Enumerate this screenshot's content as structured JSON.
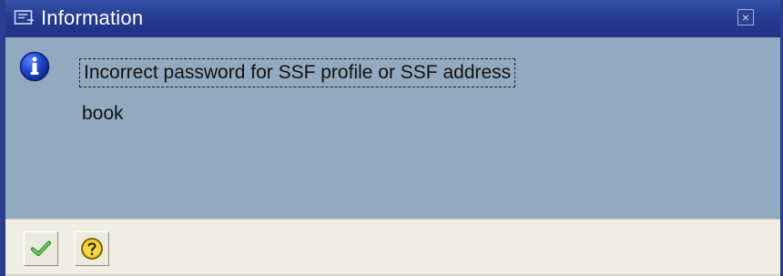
{
  "window": {
    "title": "Information",
    "title_icon": "dialog-icon",
    "close_icon": "close-icon"
  },
  "message": {
    "icon": "info-icon",
    "line1": "Incorrect password for SSF profile or SSF address",
    "line2": "book"
  },
  "footer": {
    "buttons": [
      {
        "name": "ok-button",
        "icon": "checkmark-icon"
      },
      {
        "name": "help-button",
        "icon": "question-icon"
      }
    ]
  },
  "colors": {
    "title_bar": "#23388f",
    "content_bg": "#92aabf",
    "footer_bg": "#efeee2",
    "title_text": "#ffffff"
  }
}
